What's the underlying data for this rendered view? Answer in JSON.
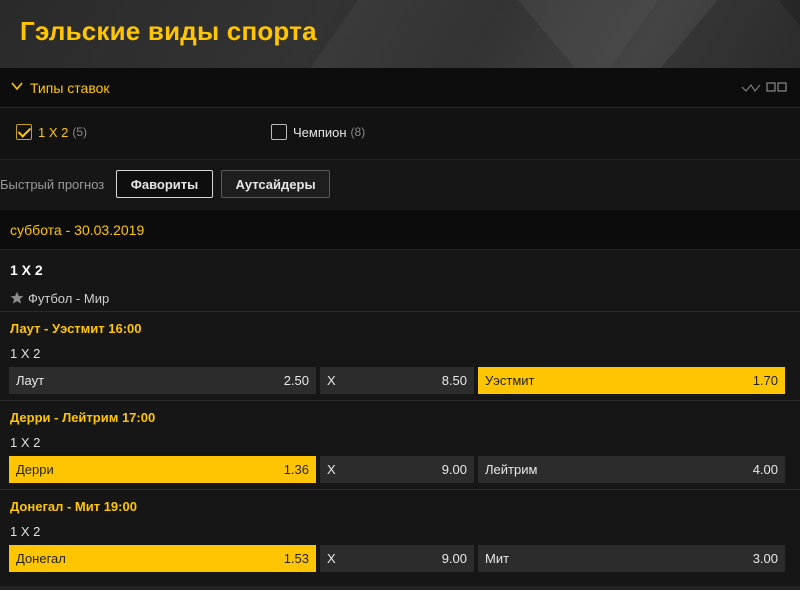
{
  "page": {
    "title": "Гэльские виды спорта"
  },
  "bet_types": {
    "title": "Типы ставок",
    "options": [
      {
        "label": "1 X 2",
        "count": "(5)",
        "checked": true
      },
      {
        "label": "Чемпион",
        "count": "(8)",
        "checked": false
      }
    ]
  },
  "quick_forecast": {
    "label": "Быстрый прогноз",
    "buttons": [
      "Фавориты",
      "Аутсайдеры"
    ]
  },
  "date": "суббота - 30.03.2019",
  "market": {
    "title": "1 X 2",
    "league": "Футбол - Мир"
  },
  "events": [
    {
      "name": "Лаут - Уэстмит 16:00",
      "market": "1 X 2",
      "odds": [
        {
          "label": "Лаут",
          "value": "2.50",
          "selected": false
        },
        {
          "label": "X",
          "value": "8.50",
          "selected": false
        },
        {
          "label": "Уэстмит",
          "value": "1.70",
          "selected": true
        }
      ]
    },
    {
      "name": "Дерри - Лейтрим 17:00",
      "market": "1 X 2",
      "odds": [
        {
          "label": "Дерри",
          "value": "1.36",
          "selected": true
        },
        {
          "label": "X",
          "value": "9.00",
          "selected": false
        },
        {
          "label": "Лейтрим",
          "value": "4.00",
          "selected": false
        }
      ]
    },
    {
      "name": "Донегал - Мит 19:00",
      "market": "1 X 2",
      "odds": [
        {
          "label": "Донегал",
          "value": "1.53",
          "selected": true
        },
        {
          "label": "X",
          "value": "9.00",
          "selected": false
        },
        {
          "label": "Мит",
          "value": "3.00",
          "selected": false
        }
      ]
    }
  ],
  "colors": {
    "accent": "#ffc600",
    "background": "#161616",
    "odd_bg": "#2c2c2c"
  }
}
